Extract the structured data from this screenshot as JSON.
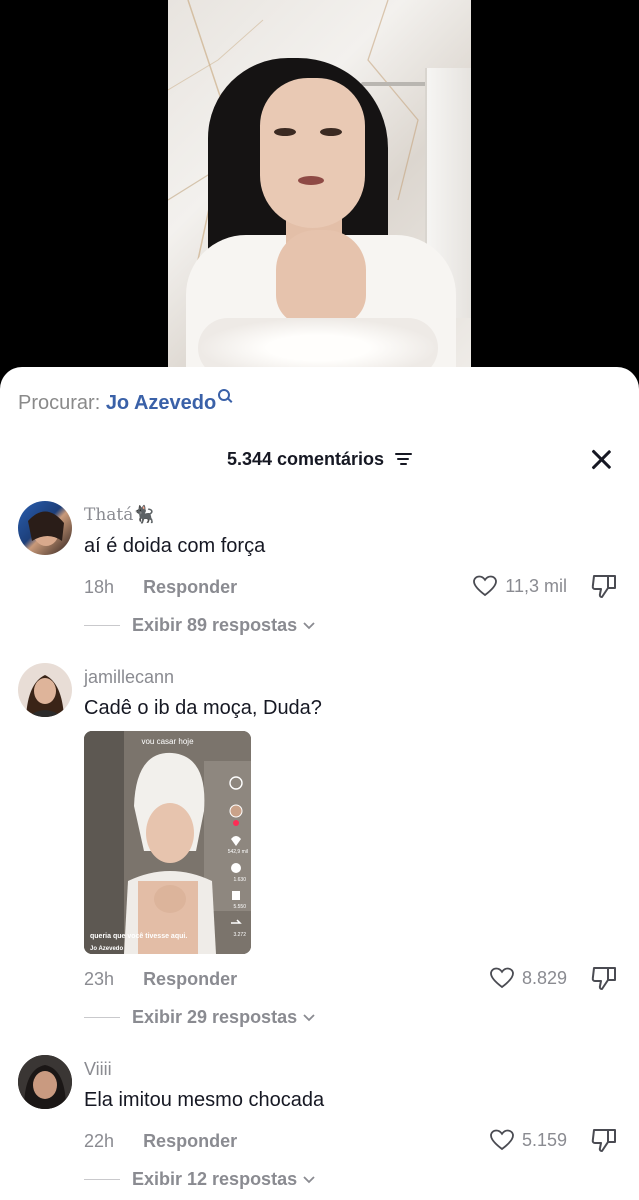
{
  "search": {
    "label": "Procurar:",
    "query": "Jo Azevedo"
  },
  "header": {
    "count_label": "5.344 comentários"
  },
  "comments": [
    {
      "username": "Thatá",
      "username_emoji": "🐈‍⬛",
      "text": "aí é doida com força",
      "time": "18h",
      "reply_label": "Responder",
      "likes": "11,3 mil",
      "replies_label": "Exibir 89 respostas"
    },
    {
      "username": "jamillecann",
      "text": "Cadê o ib da moça, Duda?",
      "attachment": {
        "top_text": "vou casar hoje",
        "caption": "queria que você tivesse aqui.",
        "author": "Jo Azevedo",
        "side_counts": [
          "542,9 mil",
          "1.630",
          "5.550",
          "3.272"
        ]
      },
      "time": "23h",
      "reply_label": "Responder",
      "likes": "8.829",
      "replies_label": "Exibir 29 respostas"
    },
    {
      "username": "Viiii",
      "text": "Ela imitou mesmo chocada",
      "time": "22h",
      "reply_label": "Responder",
      "likes": "5.159",
      "replies_label": "Exibir 12 respostas"
    }
  ],
  "colors": {
    "link": "#3a61a8",
    "muted": "#8a8b91",
    "text": "#161823"
  },
  "icons": [
    "search-icon",
    "filter-icon",
    "close-icon",
    "heart-icon",
    "dislike-icon",
    "chevron-down-icon"
  ]
}
